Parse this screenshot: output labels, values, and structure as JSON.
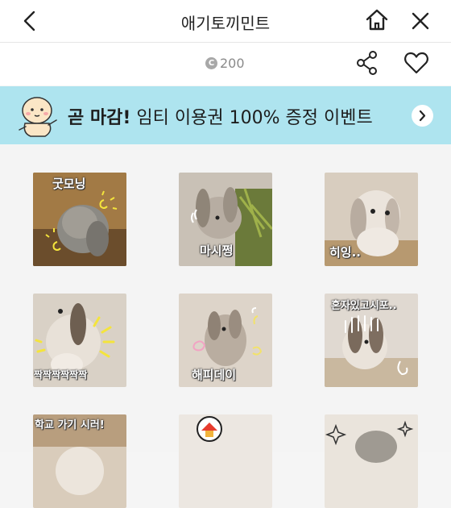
{
  "header": {
    "title": "애기토끼민트"
  },
  "info": {
    "price": "200",
    "coin_symbol": "C"
  },
  "banner": {
    "bold": "곧 마감!",
    "text": " 임티 이용권 100% 증정 이벤트",
    "bg_color": "#aee4ef"
  },
  "stickers": [
    {
      "caption": "굿모닝"
    },
    {
      "caption": "마시쩡"
    },
    {
      "caption": "히잉.."
    },
    {
      "caption": "짝짝짝짝짝짝"
    },
    {
      "caption": "해피데이"
    },
    {
      "caption": "혼자있고시포.."
    },
    {
      "caption": "학교 가기 시러!"
    },
    {
      "caption": ""
    },
    {
      "caption": ""
    }
  ]
}
